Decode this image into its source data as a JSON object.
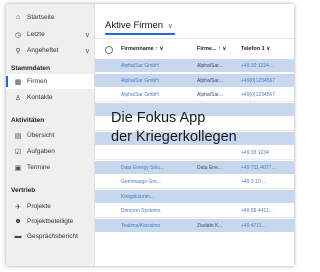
{
  "sidebar": {
    "top_items": [
      {
        "label": "Startseite",
        "icon": "home-icon"
      },
      {
        "label": "Letzte",
        "icon": "clock-icon",
        "chevron": "∨"
      },
      {
        "label": "Angeheftet",
        "icon": "pin-icon",
        "chevron": "∨"
      }
    ],
    "sections": [
      {
        "title": "Stammdaten",
        "items": [
          {
            "label": "Firmen",
            "icon": "building-icon",
            "active": true
          },
          {
            "label": "Kontakte",
            "icon": "person-icon"
          }
        ]
      },
      {
        "title": "Aktivitäten",
        "items": [
          {
            "label": "Übersicht",
            "icon": "overview-icon"
          },
          {
            "label": "Aufgaben",
            "icon": "checkbox-task-icon"
          },
          {
            "label": "Termine",
            "icon": "calendar-icon"
          }
        ]
      },
      {
        "title": "Vertrieb",
        "items": [
          {
            "label": "Projekte",
            "icon": "rocket-icon"
          },
          {
            "label": "Projektbeteiligte",
            "icon": "people-icon"
          },
          {
            "label": "Gesprächsbericht",
            "icon": "briefcase-icon"
          }
        ]
      }
    ]
  },
  "main": {
    "view_title": "Aktive Firmen",
    "columns": [
      "Firmenname ↑ ∨",
      "Firme... ↑ ∨",
      "Telefon 1 ∨"
    ],
    "rows": [
      {
        "c1": "Alpha/Sar GmbH",
        "c2": "Alpha/Sar...",
        "c3": "+49 30 1234..."
      },
      {
        "c1": "Alpha/Sar GmbH",
        "c2": "Alpha/Sar...",
        "c3": "+49(0)1234567"
      },
      {
        "c1": "Alpha/Sar GmbH",
        "c2": "Alpha/Sar...",
        "c3": "+49(0)1234567"
      },
      {
        "c1": "",
        "c2": "",
        "c3": ""
      },
      {
        "c1": "",
        "c2": "",
        "c3": ""
      },
      {
        "c1": "",
        "c2": "",
        "c3": ""
      },
      {
        "c1": "",
        "c2": "",
        "c3": "+49 33 1234"
      },
      {
        "c1": "Data Energy Solu...",
        "c2": "Data Ene...",
        "c3": "+49 711 4077..."
      },
      {
        "c1": "Gemmauge Gm...",
        "c2": "",
        "c3": "+49 3 10 ..."
      },
      {
        "c1": "Knegsklamm...",
        "c2": "",
        "c3": ""
      },
      {
        "c1": "Dimoron Systems",
        "c2": "",
        "c3": "+49 89 4411..."
      },
      {
        "c1": "Teatima/Keissimo",
        "c2": "Ziadafe K...",
        "c3": "+49 4711..."
      }
    ],
    "row_colors": [
      "blue",
      "blue",
      "white",
      "blue",
      "white",
      "blue",
      "white",
      "blue",
      "white",
      "blue",
      "white",
      "blue"
    ]
  },
  "overlay": {
    "line1": "Die Fokus App",
    "line2": "der Kriegerkollegen"
  }
}
